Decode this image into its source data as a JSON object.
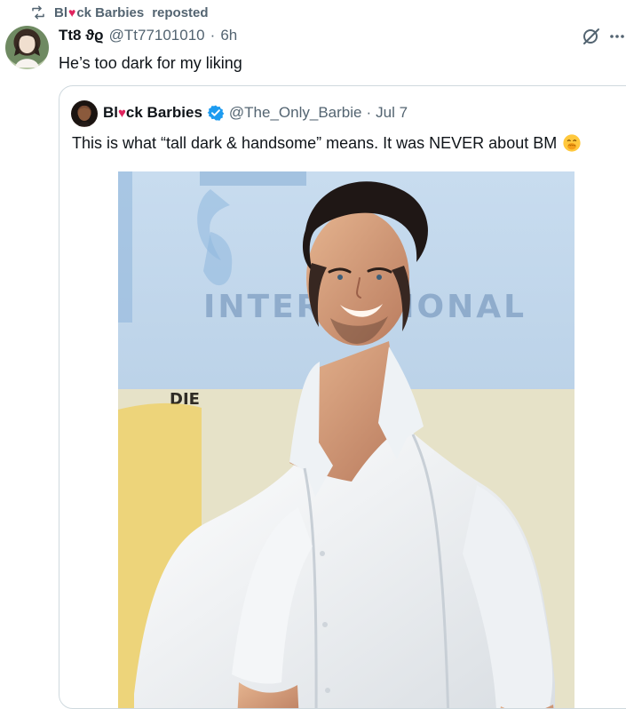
{
  "repost": {
    "name_prefix": "Bl",
    "name_heart": "♥",
    "name_suffix": "ck Barbies",
    "action_label": "reposted",
    "icon": "repost-icon"
  },
  "tweet": {
    "display_name": "Tt8 ϑϱ",
    "handle": "@Tt77101010",
    "separator": "·",
    "time": "6h",
    "text": "He’s too dark for my liking",
    "icons": [
      "grok-icon",
      "more-icon"
    ]
  },
  "quote": {
    "name_prefix": "Bl",
    "name_heart": "♥",
    "name_suffix": "ck Barbies",
    "handle": "@The_Only_Barbie",
    "separator": "·",
    "date": "Jul 7",
    "text": "This is what “tall dark & handsome” means. It was NEVER about BM",
    "emoji": "face-with-hand-over-mouth-icon",
    "photo_signage": {
      "line_1": "DIE",
      "line_2": "INTERNATIONAL"
    }
  },
  "colors": {
    "text": "#0f1419",
    "muted": "#536471",
    "border": "#cfd9de",
    "verified": "#1d9bf0",
    "heart": "#e0245e"
  }
}
